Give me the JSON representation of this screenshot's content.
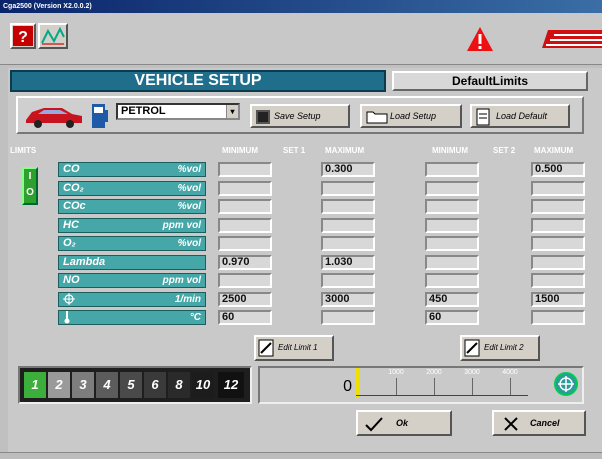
{
  "window": {
    "title": "Cga2500 (Version X2.0.0.2)"
  },
  "toolbar": {
    "icons": [
      "help-icon",
      "graph-icon",
      "warning-icon",
      "brand-logo"
    ]
  },
  "header": {
    "title": "VEHICLE SETUP",
    "limits_name": "DefaultLimits"
  },
  "fuel": {
    "selected": "PETROL",
    "save_label": "Save Setup",
    "load_label": "Load Setup",
    "default_label": "Load Default"
  },
  "limits": {
    "label": "LIMITS",
    "toggle_on": "I",
    "toggle_off": "O",
    "columns": [
      "MINIMUM",
      "SET 1",
      "MAXIMUM",
      "MINIMUM",
      "SET 2",
      "MAXIMUM"
    ],
    "rows": [
      {
        "name": "CO",
        "unit": "%vol",
        "min1": "",
        "max1": "0.300",
        "min2": "",
        "max2": "0.500"
      },
      {
        "name": "CO₂",
        "unit": "%vol",
        "min1": "",
        "max1": "",
        "min2": "",
        "max2": ""
      },
      {
        "name": "COc",
        "unit": "%vol",
        "min1": "",
        "max1": "",
        "min2": "",
        "max2": ""
      },
      {
        "name": "HC",
        "unit": "ppm vol",
        "min1": "",
        "max1": "",
        "min2": "",
        "max2": ""
      },
      {
        "name": "O₂",
        "unit": "%vol",
        "min1": "",
        "max1": "",
        "min2": "",
        "max2": ""
      },
      {
        "name": "Lambda",
        "unit": "",
        "min1": "0.970",
        "max1": "1.030",
        "min2": "",
        "max2": ""
      },
      {
        "name": "NO",
        "unit": "ppm vol",
        "min1": "",
        "max1": "",
        "min2": "",
        "max2": ""
      },
      {
        "name": "",
        "unit": "1/min",
        "min1": "2500",
        "max1": "3000",
        "min2": "450",
        "max2": "1500"
      },
      {
        "name": "",
        "unit": "°C",
        "min1": "60",
        "max1": "",
        "min2": "60",
        "max2": ""
      }
    ],
    "edit1": "Edit Limit 1",
    "edit2": "Edit Limit 2"
  },
  "rpm_selector": {
    "options": [
      "1",
      "2",
      "3",
      "4",
      "5",
      "6",
      "8",
      "10",
      "12"
    ],
    "selected": "1"
  },
  "gauge": {
    "value": "0",
    "ticks": [
      "1000",
      "2000",
      "3000",
      "4000"
    ]
  },
  "actions": {
    "ok": "Ok",
    "cancel": "Cancel"
  }
}
